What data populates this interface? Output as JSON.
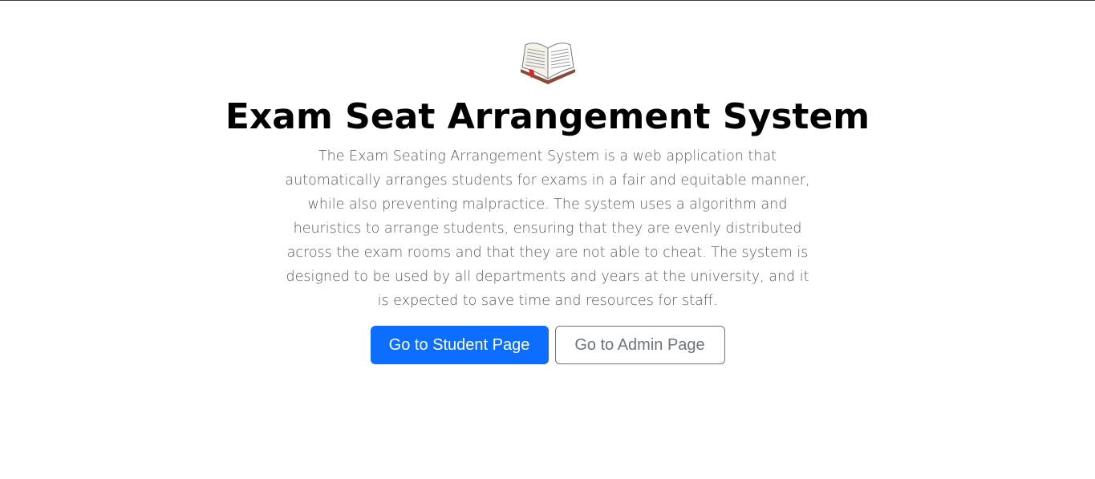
{
  "hero": {
    "icon": "open-book-icon",
    "title": "Exam Seat Arrangement System",
    "description": "The Exam Seating Arrangement System is a web application that automatically arranges students for exams in a fair and equitable manner, while also preventing malpractice. The system uses a algorithm and heuristics to arrange students, ensuring that they are evenly distributed across the exam rooms and that they are not able to cheat. The system is designed to be used by all departments and years at the university, and it is expected to save time and resources for staff."
  },
  "actions": {
    "student_label": "Go to Student Page",
    "admin_label": "Go to Admin Page"
  },
  "colors": {
    "primary": "#0d6efd",
    "secondary": "#6c757d",
    "title": "#000000",
    "description": "#555a60"
  }
}
